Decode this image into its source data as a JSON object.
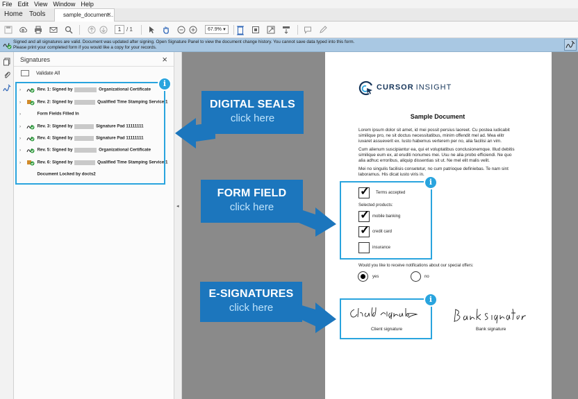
{
  "menu": [
    "File",
    "Edit",
    "View",
    "Window",
    "Help"
  ],
  "tabs": {
    "home": "Home",
    "tools": "Tools",
    "document": "sample_document..."
  },
  "toolbar": {
    "page_current": "1",
    "page_total": "/ 1",
    "zoom": "67.9%"
  },
  "notification": {
    "line1": "Signed and all signatures are valid. Document was updated after signing. Open Signature Panel to view the document change history.  You cannot save data typed into this form.",
    "line2": "Please print your completed form if you would like a copy for your records."
  },
  "signature_panel": {
    "title": "Signatures",
    "validate_all": "Validate All",
    "rows": [
      {
        "prefix": "Rev. 1: Signed by",
        "suffix": "Organizational Certificate"
      },
      {
        "prefix": "Rev. 2: Signed by",
        "suffix": "Qualified Time Stamping Service 1"
      },
      {
        "prefix": "Form Fields Filled In",
        "suffix": ""
      },
      {
        "prefix": "Rev. 3: Signed by",
        "suffix": "Signature Pad 11111111"
      },
      {
        "prefix": "Rev. 4: Signed by",
        "suffix": "Signature Pad 11111111"
      },
      {
        "prefix": "Rev. 5: Signed by",
        "suffix": "Organizational Certificate"
      },
      {
        "prefix": "Rev. 6: Signed by",
        "suffix": "Qualified Time Stamping Service 1"
      },
      {
        "prefix": "Document Locked by docts2",
        "suffix": ""
      }
    ]
  },
  "callouts": {
    "digital_seals": {
      "heading": "DIGITAL SEALS",
      "action": "click here"
    },
    "form_field": {
      "heading": "FORM FIELD",
      "action": "click here"
    },
    "e_signatures": {
      "heading": "E-SIGNATURES",
      "action": "click here"
    }
  },
  "document": {
    "logo_word1": "CURSOR",
    "logo_word2": "INSIGHT",
    "title": "Sample Document",
    "paragraphs": [
      "Lorem ipsum dolor sit amet, id mei possit persius laoreet. Cu postea iudicabit similique pro, ne sit doctus necessitatibus, minim offendit mel ad. Mea elitr iuvaret assueverit ex. Iusto habemus verterem per no, alia facilisi an vim.",
      "Cum alienum suscipiantur ea, qui et voluptatibus conclusionemque. Illud debitis similique eum ex, at eruditi nonumes mei. Usu ne alia probo efficiendi. Ne quo alia adhuc erroribus, aliquip dissentias sit ut. Ne mel elit malis velit.",
      "Mei no singulis facilisis consetetur, no cum patrioque definiebas. Te nam sint laboramus. His dicat iusto viris in."
    ],
    "terms_label": "Terms accepted",
    "products_label": "Selected products:",
    "products": [
      "mobile banking",
      "credit card",
      "insurance"
    ],
    "notify_question": "Would you like to receive notifications about our special offers:",
    "radio_yes": "yes",
    "radio_no": "no",
    "client_signature_caption": "Client signature",
    "bank_signature_caption": "Bank signature"
  },
  "colors": {
    "accent": "#29a4de",
    "callout_bg": "#1c76bd",
    "callout_action": "#bfe3fb",
    "notify_bg": "#a9c8e3",
    "doc_bg": "#8a8a8a"
  },
  "icons": [
    "save-icon",
    "upload-icon",
    "print-icon",
    "mail-icon",
    "search-icon",
    "arrow-up-icon",
    "arrow-down-icon",
    "cursor-icon",
    "hand-icon",
    "zoom-out-icon",
    "zoom-in-icon",
    "fit-icon",
    "comment-icon",
    "pen-icon"
  ]
}
